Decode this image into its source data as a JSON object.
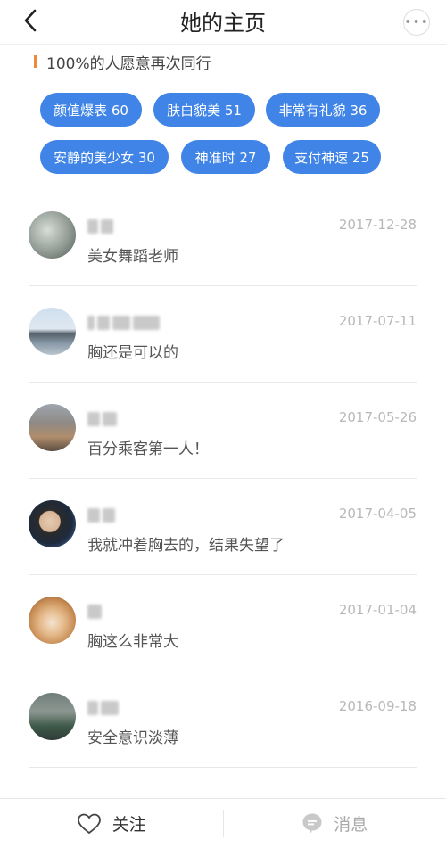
{
  "header": {
    "title": "她的主页"
  },
  "summary": {
    "text": "100%的人愿意再次同行"
  },
  "tags": [
    {
      "label": "颜值爆表 60"
    },
    {
      "label": "肤白貌美 51"
    },
    {
      "label": "非常有礼貌 36"
    },
    {
      "label": "安静的美少女 30"
    },
    {
      "label": "神准时 27"
    },
    {
      "label": "支付神速 25"
    }
  ],
  "reviews": [
    {
      "date": "2017-12-28",
      "comment": "美女舞蹈老师"
    },
    {
      "date": "2017-07-11",
      "comment": "胸还是可以的"
    },
    {
      "date": "2017-05-26",
      "comment": "百分乘客第一人！"
    },
    {
      "date": "2017-04-05",
      "comment": "我就冲着胸去的，结果失望了"
    },
    {
      "date": "2017-01-04",
      "comment": "胸这么非常大"
    },
    {
      "date": "2016-09-18",
      "comment": "安全意识淡薄"
    }
  ],
  "bottom_bar": {
    "follow_label": "关注",
    "message_label": "消息"
  }
}
